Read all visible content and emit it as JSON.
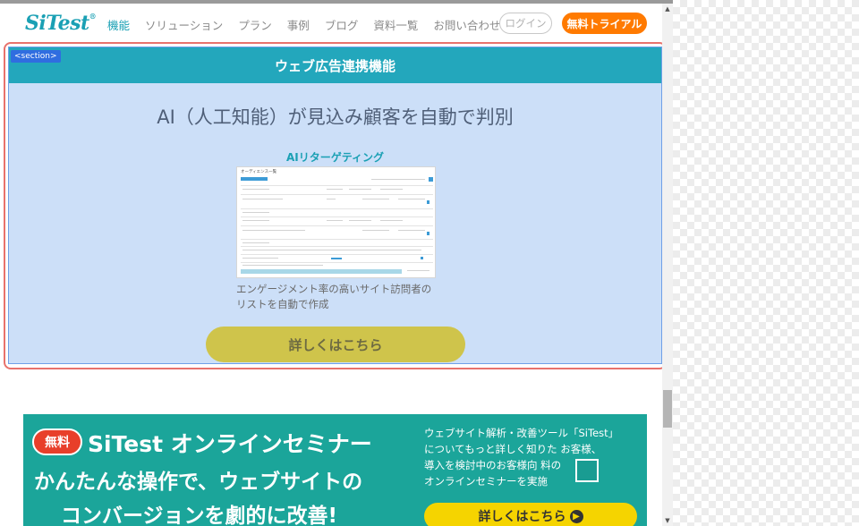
{
  "header": {
    "logo": "SiTest",
    "logo_mark": "®",
    "nav": [
      "機能",
      "ソリューション",
      "プラン",
      "事例",
      "ブログ",
      "資料一覧",
      "お問い合わせ"
    ],
    "login": "ログイン",
    "trial": "無料トライアル"
  },
  "section": {
    "tag": "<section>",
    "title": "ウェブ広告連携機能",
    "headline": "AI（人工知能）が見込み顧客を自動で判別",
    "feature_title": "AIリターゲティング",
    "feature_desc_line1": "エンゲージメント率の高いサイト訪問者の",
    "feature_desc_line2": "リストを自動で作成",
    "button": "詳しくはこちら",
    "screenshot_label": "オーディエンス一覧"
  },
  "banner": {
    "badge": "無料",
    "title": "SiTest オンラインセミナー",
    "copy1": "かんたんな操作で、ウェブサイトの",
    "copy2": "コンバージョンを劇的に改善!",
    "desc_line1": "ウェブサイト解析・改善ツール「SiTest」",
    "desc_line2": "についてもっと詳しく知りた  お客様、",
    "desc_line3": "導入を検討中のお客様向    料の",
    "desc_line4": "オンラインセミナーを実施",
    "button": "詳しくはこちら",
    "button_icon": "chevron-right-circle-icon"
  },
  "colors": {
    "brand": "#1aa0b4",
    "section_bg": "#ccdff8",
    "title_bar": "#23a7bc",
    "cta_button": "#cfc44b",
    "trial": "#ff7a00",
    "banner": "#1ba59a",
    "banner_button": "#f5d400",
    "highlight_outline": "#e8726c"
  }
}
